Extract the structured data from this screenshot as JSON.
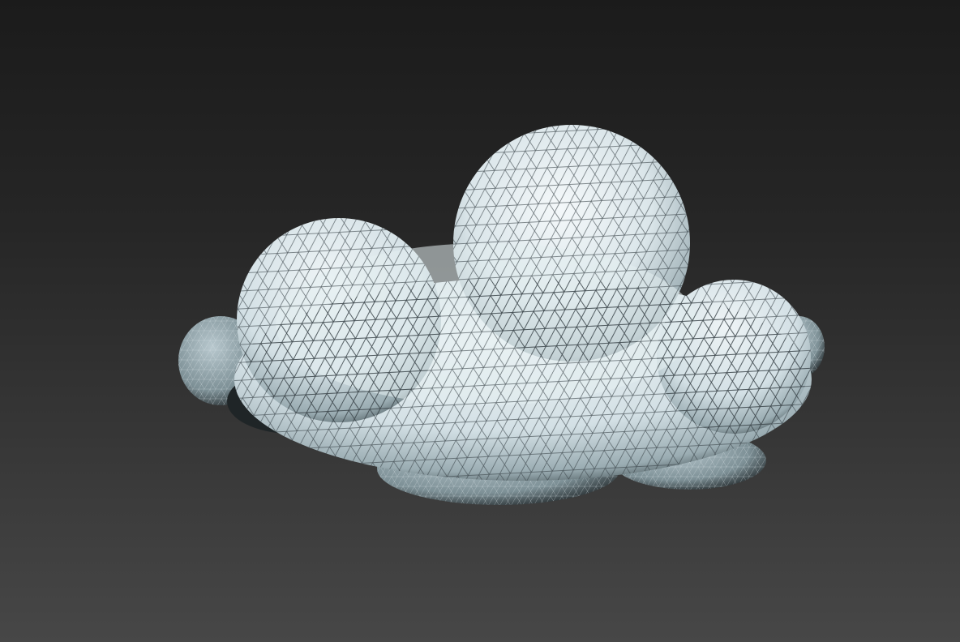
{
  "viewport": {
    "object": "cloud-mesh",
    "display_mode": "shaded-wireframe",
    "colors": {
      "background_top": "#1b1b1b",
      "background_bottom": "#474747",
      "surface_light": "#f2f6f8",
      "surface_mid": "#c9d8de",
      "surface_shadow": "#6f8288",
      "wire": "#3a4448"
    }
  }
}
